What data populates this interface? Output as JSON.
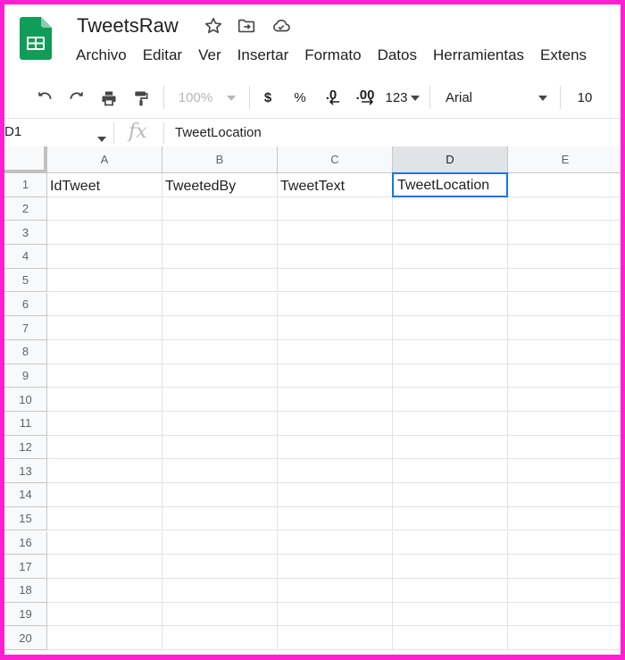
{
  "doc": {
    "title": "TweetsRaw",
    "icons": [
      "star-icon",
      "move-to-folder-icon",
      "cloud-saved-icon"
    ]
  },
  "menu": [
    "Archivo",
    "Editar",
    "Ver",
    "Insertar",
    "Formato",
    "Datos",
    "Herramientas",
    "Extens"
  ],
  "toolbar": {
    "zoom": "100%",
    "currency": "$",
    "percent": "%",
    "decrease_decimal": ".0",
    "increase_decimal": ".00",
    "more_formats": "123",
    "font": "Arial",
    "font_size": "10"
  },
  "formula_bar": {
    "name_box": "D1",
    "fx": "fx",
    "value": "TweetLocation"
  },
  "sheet": {
    "columns": [
      "A",
      "B",
      "C",
      "D",
      "E"
    ],
    "selected_column": "D",
    "rows": [
      "1",
      "2",
      "3",
      "4",
      "5",
      "6",
      "7",
      "8",
      "9",
      "10",
      "11",
      "12",
      "13",
      "14",
      "15",
      "16",
      "17",
      "18",
      "19",
      "20"
    ],
    "row1": [
      "IdTweet",
      "TweetedBy",
      "TweetText",
      "TweetLocation",
      ""
    ],
    "active_cell": "D1"
  },
  "colors": {
    "accent": "#1a73e8",
    "sheets_green": "#0f9d58",
    "frame": "#ff1fd3"
  }
}
